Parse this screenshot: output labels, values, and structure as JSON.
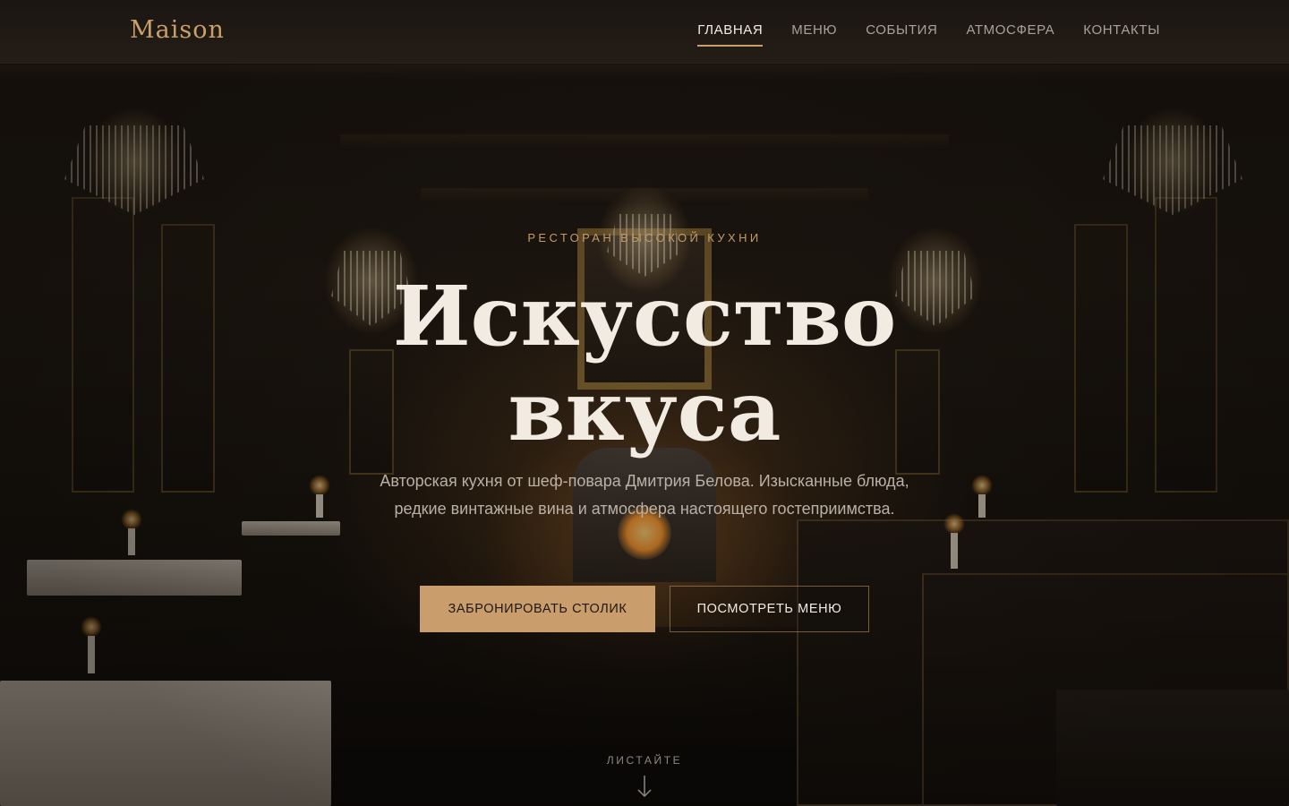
{
  "colors": {
    "accent": "#c9a06a",
    "button_primary_bg": "#c99d6c",
    "headline": "#f1ebe1",
    "nav_active": "#f2ece4",
    "nav_inactive": "#a9a29a"
  },
  "header": {
    "logo": "Maison",
    "nav": [
      {
        "label": "ГЛАВНАЯ",
        "active": true
      },
      {
        "label": "МЕНЮ",
        "active": false
      },
      {
        "label": "СОБЫТИЯ",
        "active": false
      },
      {
        "label": "АТМОСФЕРА",
        "active": false
      },
      {
        "label": "КОНТАКТЫ",
        "active": false
      }
    ]
  },
  "hero": {
    "eyebrow": "РЕСТОРАН ВЫСОКОЙ КУХНИ",
    "headline_line1": "Искусство",
    "headline_line2": "вкуса",
    "subtitle": "Авторская кухня от шеф-повара Дмитрия Белова. Изысканные блюда, редкие винтажные вина и атмосфера настоящего гостеприимства.",
    "primary_button": "ЗАБРОНИРОВАТЬ СТОЛИК",
    "secondary_button": "ПОСМОТРЕТЬ МЕНЮ",
    "scroll_label": "ЛИСТАЙТЕ",
    "scroll_icon": "arrow-down-icon",
    "background_image": "restaurant-interior-photo"
  }
}
